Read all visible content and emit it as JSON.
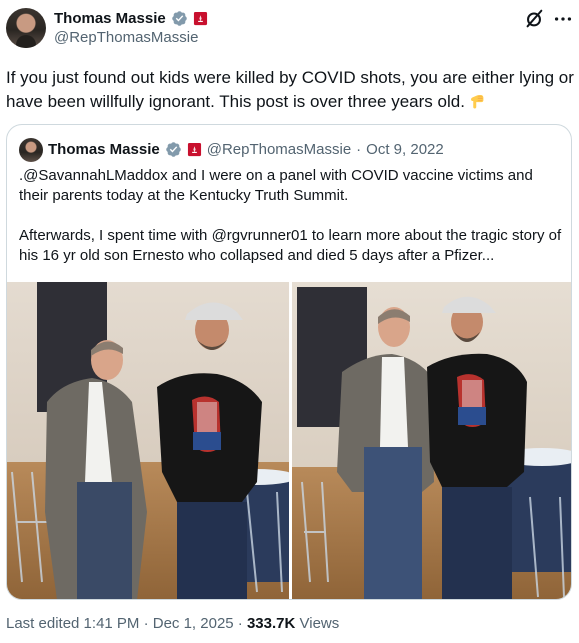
{
  "author": {
    "display_name": "Thomas Massie",
    "handle": "@RepThomasMassie"
  },
  "post": {
    "text": "If you just found out kids were killed by COVID shots, you are either lying or have been willfully ignorant. This post is over three years old.",
    "emoji": "backhand-index-pointing-down"
  },
  "quoted_post": {
    "display_name": "Thomas Massie",
    "handle": "@RepThomasMassie",
    "separator": "·",
    "date": "Oct 9, 2022",
    "paragraph_1": ".@SavannahLMaddox and I were on a panel with COVID vaccine victims and their parents today at the Kentucky Truth Summit.",
    "paragraph_2": "Afterwards, I spent time with @rgvrunner01 to learn more about the tragic story of his 16 yr old son Ernesto who collapsed and died 5 days after a Pfizer..."
  },
  "meta": {
    "edited_label": "Last edited 1:41 PM · Dec 1, 2025 · ",
    "views_count": "333.7K",
    "views_label": " Views"
  },
  "icons": {
    "verified": "verified-badge-icon",
    "affiliation": "government-affiliation-icon",
    "grok": "grok-icon",
    "more": "more-icon"
  },
  "colors": {
    "text_primary": "#0f1419",
    "text_secondary": "#536471",
    "verified_blue": "#1d9bf0",
    "border": "#cfd9de",
    "affiliation_red": "#c8102e"
  }
}
